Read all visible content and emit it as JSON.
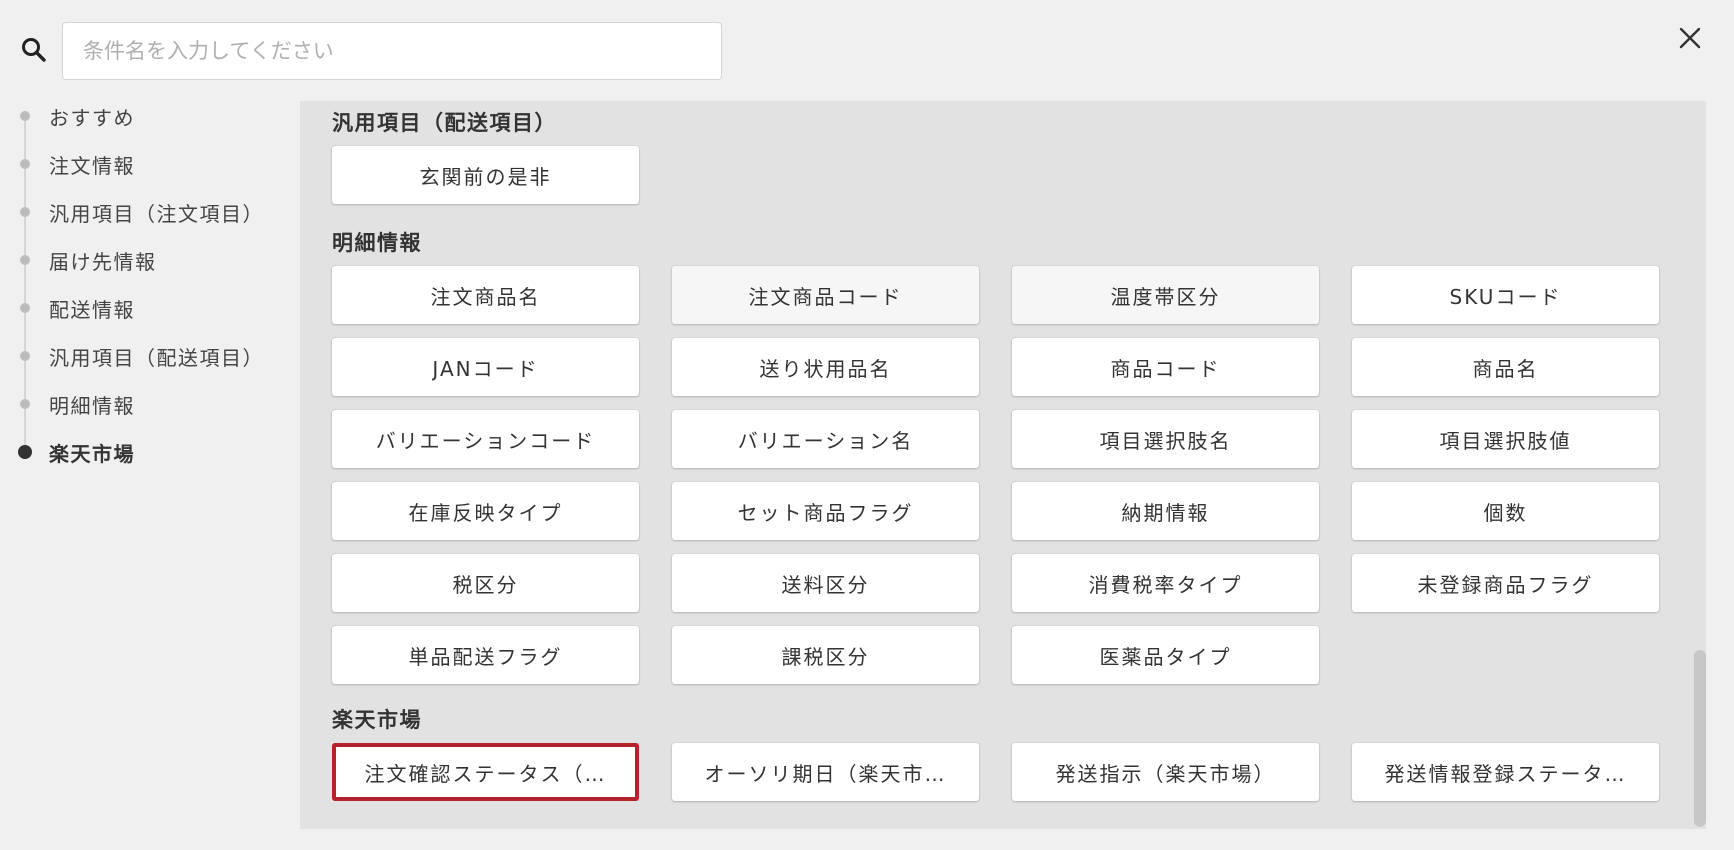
{
  "search": {
    "placeholder": "条件名を入力してください",
    "icon": "search-icon"
  },
  "close": {
    "icon": "close-icon"
  },
  "nav": {
    "items": [
      {
        "label": "おすすめ",
        "active": false
      },
      {
        "label": "注文情報",
        "active": false
      },
      {
        "label": "汎用項目（注文項目）",
        "active": false
      },
      {
        "label": "届け先情報",
        "active": false
      },
      {
        "label": "配送情報",
        "active": false
      },
      {
        "label": "汎用項目（配送項目）",
        "active": false
      },
      {
        "label": "明細情報",
        "active": false
      },
      {
        "label": "楽天市場",
        "active": true
      }
    ]
  },
  "sections": {
    "delivery_generic": {
      "title": "汎用項目（配送項目）",
      "items": [
        "玄関前の是非"
      ]
    },
    "details": {
      "title": "明細情報",
      "items": [
        "注文商品名",
        "注文商品コード",
        "温度帯区分",
        "SKUコード",
        "JANコード",
        "送り状用品名",
        "商品コード",
        "商品名",
        "バリエーションコード",
        "バリエーション名",
        "項目選択肢名",
        "項目選択肢値",
        "在庫反映タイプ",
        "セット商品フラグ",
        "納期情報",
        "個数",
        "税区分",
        "送料区分",
        "消費税率タイプ",
        "未登録商品フラグ",
        "単品配送フラグ",
        "課税区分",
        "医薬品タイプ"
      ]
    },
    "rakuten": {
      "title": "楽天市場",
      "items": [
        "注文確認ステータス（…",
        "オーソリ期日（楽天市…",
        "発送指示（楽天市場）",
        "発送情報登録ステータ…"
      ]
    }
  },
  "colors": {
    "selected_border": "#b5222c",
    "panel_bg": "#e2e2e2",
    "page_bg": "#f0f0f0"
  }
}
